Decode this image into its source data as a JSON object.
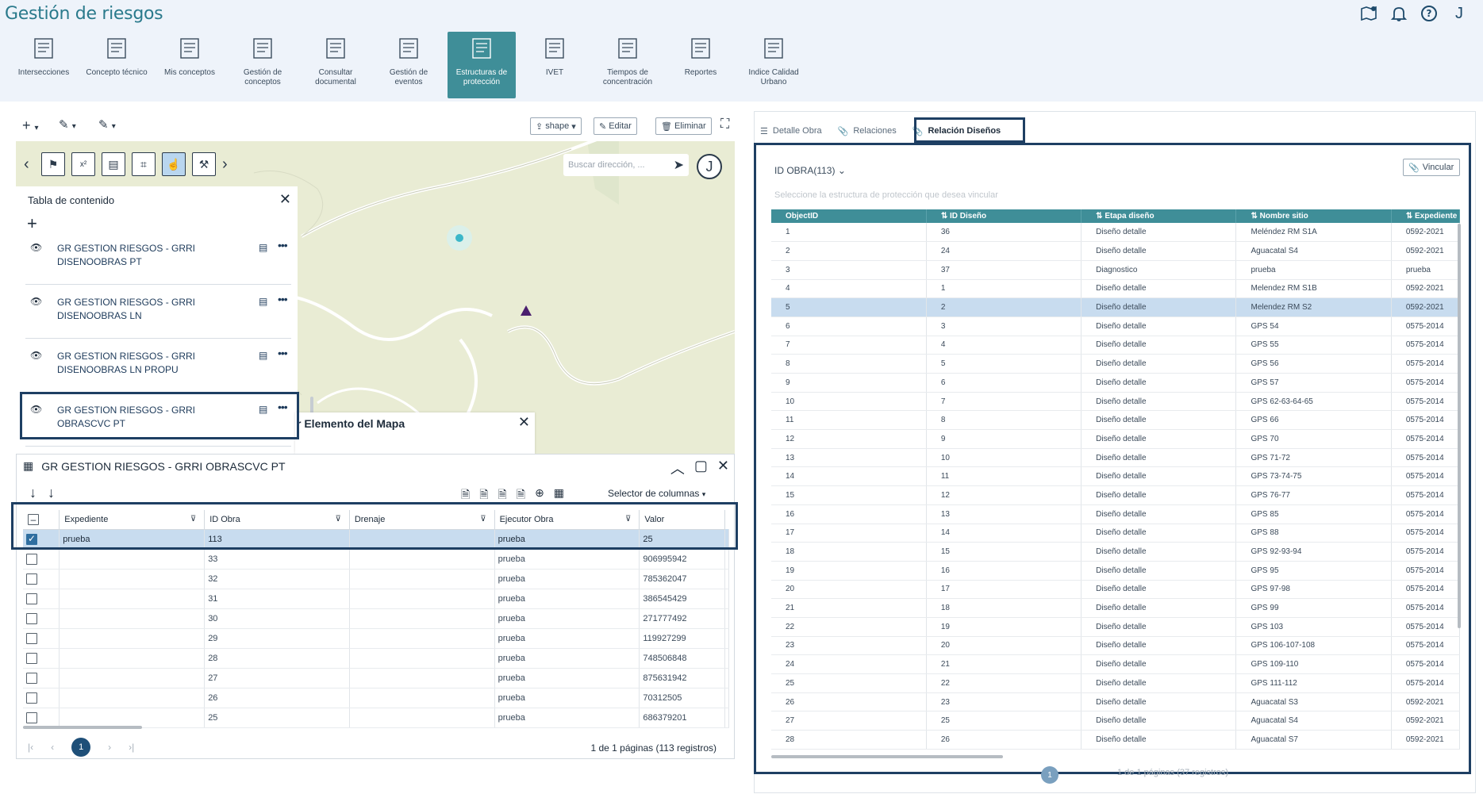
{
  "app": {
    "title": "Gestión de riesgos",
    "user_initial": "J"
  },
  "header_icons": [
    "map-alert-icon",
    "bell-icon",
    "help-icon"
  ],
  "modules": [
    {
      "label": "Intersecciones",
      "icon": "intersections-icon",
      "active": false
    },
    {
      "label": "Concepto técnico",
      "icon": "technical-concept-icon",
      "active": false
    },
    {
      "label": "Mis conceptos",
      "icon": "my-concepts-icon",
      "active": false
    },
    {
      "label": "Gestión de conceptos",
      "icon": "concept-management-icon",
      "active": false
    },
    {
      "label": "Consultar documental",
      "icon": "document-query-icon",
      "active": false
    },
    {
      "label": "Gestión de eventos",
      "icon": "event-management-icon",
      "active": false
    },
    {
      "label": "Estructuras de protección",
      "icon": "protection-structures-icon",
      "active": true
    },
    {
      "label": "IVET",
      "icon": "ivet-icon",
      "active": false
    },
    {
      "label": "Tiempos de concentración",
      "icon": "concentration-time-icon",
      "active": false
    },
    {
      "label": "Reportes",
      "icon": "reports-icon",
      "active": false
    },
    {
      "label": "Indice Calidad Urbano",
      "icon": "urban-quality-icon",
      "active": false
    }
  ],
  "map_toolbar": {
    "shape_label": "shape",
    "edit_label": "Editar",
    "delete_label": "Eliminar"
  },
  "map": {
    "search_placeholder": "Buscar dirección, ...",
    "user_initial": "J"
  },
  "toc": {
    "title": "Tabla de contenido",
    "items": [
      {
        "line1": "GR GESTION RIESGOS - GRRI",
        "line2": "DISENOOBRAS PT"
      },
      {
        "line1": "GR GESTION RIESGOS - GRRI",
        "line2": "DISENOOBRAS LN"
      },
      {
        "line1": "GR GESTION RIESGOS - GRRI",
        "line2": "DISENOOBRAS LN PROPU"
      },
      {
        "line1": "GR GESTION RIESGOS - GRRI",
        "line2": "OBRASCVC PT"
      }
    ]
  },
  "popup": {
    "title": "r Elemento del Mapa"
  },
  "attr_table": {
    "title": "GR GESTION RIESGOS - GRRI OBRASCVC PT",
    "column_selector": "Selector de columnas",
    "columns": [
      "Expediente",
      "ID Obra",
      "Drenaje",
      "Ejecutor Obra",
      "Valor"
    ],
    "rows": [
      [
        "prueba",
        "113",
        "",
        "prueba",
        "25"
      ],
      [
        "",
        "33",
        "",
        "prueba",
        "906995942"
      ],
      [
        "",
        "32",
        "",
        "prueba",
        "785362047"
      ],
      [
        "",
        "31",
        "",
        "prueba",
        "386545429"
      ],
      [
        "",
        "30",
        "",
        "prueba",
        "271777492"
      ],
      [
        "",
        "29",
        "",
        "prueba",
        "119927299"
      ],
      [
        "",
        "28",
        "",
        "prueba",
        "748506848"
      ],
      [
        "",
        "27",
        "",
        "prueba",
        "875631942"
      ],
      [
        "",
        "26",
        "",
        "prueba",
        "70312505"
      ],
      [
        "",
        "25",
        "",
        "prueba",
        "686379201"
      ]
    ],
    "pager_page": "1",
    "pager_info": "1 de 1 páginas (113 registros)"
  },
  "right": {
    "tabs": [
      "Detalle Obra",
      "Relaciones",
      "Relación Diseños"
    ],
    "dropdown": "ID OBRA(113)",
    "vincular": "Vincular",
    "hint": "Seleccione la estructura de protección que desea vincular",
    "columns": [
      "ObjectID",
      "ID Diseño",
      "Etapa diseño",
      "Nombre sitio",
      "Expediente"
    ],
    "rows": [
      [
        "1",
        "36",
        "Diseño detalle",
        "Meléndez RM S1A",
        "0592-2021"
      ],
      [
        "2",
        "24",
        "Diseño detalle",
        "Aguacatal S4",
        "0592-2021"
      ],
      [
        "3",
        "37",
        "Diagnostico",
        "prueba",
        "prueba"
      ],
      [
        "4",
        "1",
        "Diseño detalle",
        "Melendez RM S1B",
        "0592-2021"
      ],
      [
        "5",
        "2",
        "Diseño detalle",
        "Melendez RM S2",
        "0592-2021"
      ],
      [
        "6",
        "3",
        "Diseño detalle",
        "GPS 54",
        "0575-2014"
      ],
      [
        "7",
        "4",
        "Diseño detalle",
        "GPS 55",
        "0575-2014"
      ],
      [
        "8",
        "5",
        "Diseño detalle",
        "GPS 56",
        "0575-2014"
      ],
      [
        "9",
        "6",
        "Diseño detalle",
        "GPS 57",
        "0575-2014"
      ],
      [
        "10",
        "7",
        "Diseño detalle",
        "GPS 62-63-64-65",
        "0575-2014"
      ],
      [
        "11",
        "8",
        "Diseño detalle",
        "GPS 66",
        "0575-2014"
      ],
      [
        "12",
        "9",
        "Diseño detalle",
        "GPS 70",
        "0575-2014"
      ],
      [
        "13",
        "10",
        "Diseño detalle",
        "GPS 71-72",
        "0575-2014"
      ],
      [
        "14",
        "11",
        "Diseño detalle",
        "GPS 73-74-75",
        "0575-2014"
      ],
      [
        "15",
        "12",
        "Diseño detalle",
        "GPS 76-77",
        "0575-2014"
      ],
      [
        "16",
        "13",
        "Diseño detalle",
        "GPS 85",
        "0575-2014"
      ],
      [
        "17",
        "14",
        "Diseño detalle",
        "GPS 88",
        "0575-2014"
      ],
      [
        "18",
        "15",
        "Diseño detalle",
        "GPS 92-93-94",
        "0575-2014"
      ],
      [
        "19",
        "16",
        "Diseño detalle",
        "GPS 95",
        "0575-2014"
      ],
      [
        "20",
        "17",
        "Diseño detalle",
        "GPS 97-98",
        "0575-2014"
      ],
      [
        "21",
        "18",
        "Diseño detalle",
        "GPS 99",
        "0575-2014"
      ],
      [
        "22",
        "19",
        "Diseño detalle",
        "GPS 103",
        "0575-2014"
      ],
      [
        "23",
        "20",
        "Diseño detalle",
        "GPS 106-107-108",
        "0575-2014"
      ],
      [
        "24",
        "21",
        "Diseño detalle",
        "GPS 109-110",
        "0575-2014"
      ],
      [
        "25",
        "22",
        "Diseño detalle",
        "GPS 111-112",
        "0575-2014"
      ],
      [
        "26",
        "23",
        "Diseño detalle",
        "Aguacatal S3",
        "0592-2021"
      ],
      [
        "27",
        "25",
        "Diseño detalle",
        "Aguacatal S4",
        "0592-2021"
      ],
      [
        "28",
        "26",
        "Diseño detalle",
        "Aguacatal S7",
        "0592-2021"
      ]
    ],
    "selected_row": "5",
    "pager_page": "1",
    "pager_info": "1 de 1 páginas (37 registros)"
  },
  "colors": {
    "accent": "#3f8e98",
    "title": "#2a7a8c",
    "highlight": "#1e3f63",
    "selected_row": "#c8dcef",
    "map_bg": "#e8ebd2"
  }
}
